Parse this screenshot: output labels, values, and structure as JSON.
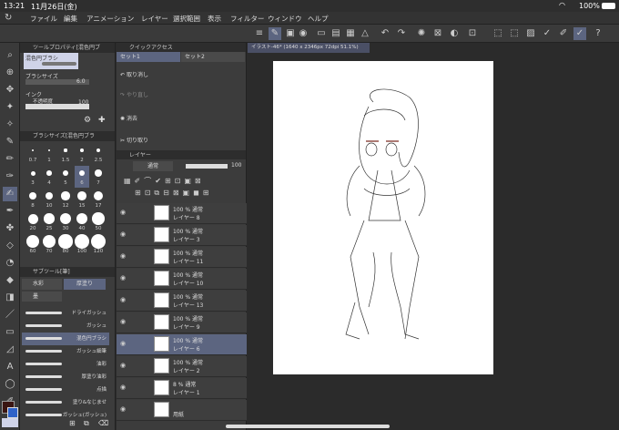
{
  "status": {
    "time": "13:21",
    "date": "11月26日(金)",
    "battery": "100%"
  },
  "menu": [
    "ファイル",
    "編集",
    "アニメーション",
    "レイヤー",
    "選択範囲",
    "表示",
    "フィルター",
    "ウィンドウ",
    "ヘルプ"
  ],
  "tool_property": {
    "title": "ツールプロパティ[混色円ブ",
    "brush_name": "混色円ブラシ",
    "brush_size_label": "ブラシサイズ",
    "brush_size_value": "6.0",
    "ink_label": "インク",
    "opacity_label": "不透明度",
    "opacity_value": "100"
  },
  "brush_size_panel": {
    "title": "ブラシサイズ[混色円ブラ",
    "sizes_row1": [
      "0.7",
      "1",
      "1.5",
      "2",
      "2.5"
    ],
    "sizes_row2": [
      "3",
      "4",
      "5",
      "6",
      "7"
    ],
    "sizes_row3": [
      "8",
      "10",
      "12",
      "15",
      "17"
    ],
    "sizes_row4": [
      "20",
      "25",
      "30",
      "40",
      "50"
    ],
    "sizes_row5": [
      "60",
      "70",
      "80",
      "100",
      "120"
    ]
  },
  "subtool": {
    "title": "サブツール[筆]",
    "tab1": "水彩",
    "tab2": "厚塗り",
    "tab3": "墨",
    "items": [
      "ドライガッシュ",
      "ガッシュ",
      "混色円ブラシ",
      "ガッシュ細筆",
      "油彩",
      "厚塗り油彩",
      "点描",
      "塗り&なじませ",
      "ガッシュ(ガッシュ)"
    ]
  },
  "quick_access": {
    "title": "クイックアクセス",
    "tab1": "セット1",
    "tab2": "セット2",
    "items": [
      "取り消し",
      "やり直し",
      "消去",
      "切り取り"
    ]
  },
  "layer_panel": {
    "title": "レイヤー",
    "blend_mode": "通常",
    "opacity": "100",
    "layers": [
      {
        "pct": "100 % 通常",
        "name": "レイヤー 8"
      },
      {
        "pct": "100 % 通常",
        "name": "レイヤー 3"
      },
      {
        "pct": "100 % 通常",
        "name": "レイヤー 11"
      },
      {
        "pct": "100 % 通常",
        "name": "レイヤー 10"
      },
      {
        "pct": "100 % 通常",
        "name": "レイヤー 13"
      },
      {
        "pct": "100 % 通常",
        "name": "レイヤー 9"
      },
      {
        "pct": "100 % 通常",
        "name": "レイヤー 6"
      },
      {
        "pct": "100 % 通常",
        "name": "レイヤー 2"
      },
      {
        "pct": "8 % 通常",
        "name": "レイヤー 1"
      },
      {
        "pct": "",
        "name": "用紙"
      }
    ]
  },
  "canvas": {
    "tab_title": "イラスト-46* (1640 x 2346px 72dpi 51.1%)"
  },
  "colors": {
    "main": "#cfd3e8",
    "sub": "#5c6580"
  }
}
